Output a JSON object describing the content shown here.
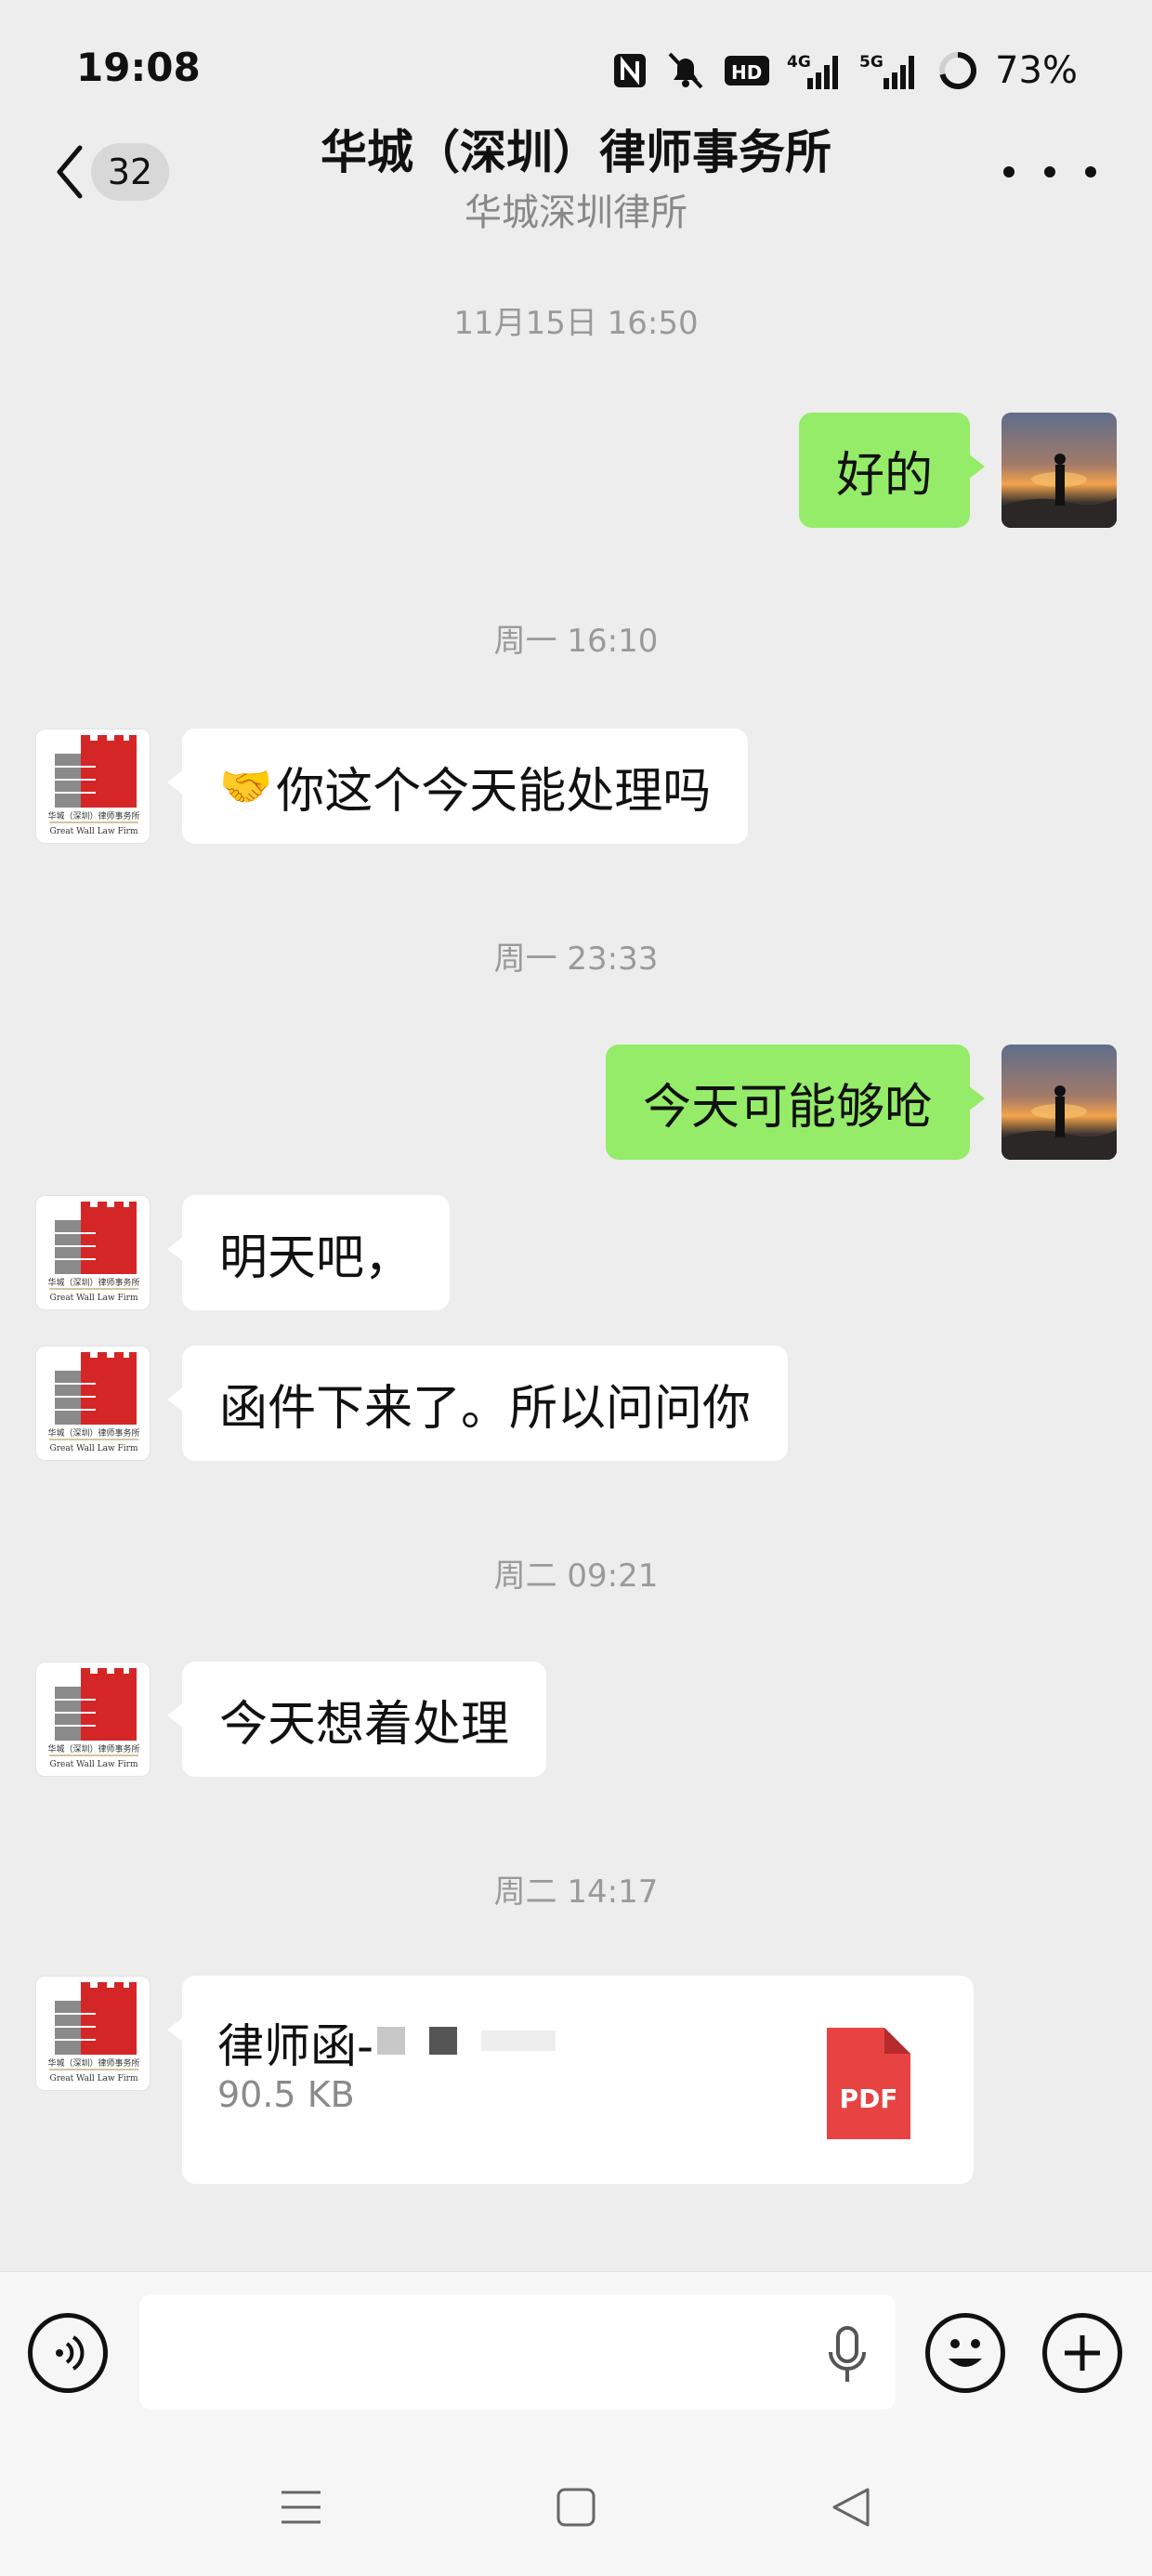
{
  "status_bar": {
    "time": "19:08",
    "icons": [
      "nfc-icon",
      "mute-icon",
      "hd-icon",
      "4g-signal-icon",
      "5g-signal-icon",
      "battery-icon"
    ],
    "hd_label": "HD",
    "net_4g": "4G",
    "net_5g": "5G",
    "battery": "73%"
  },
  "header": {
    "unread_count": "32",
    "title": "华城（深圳）律师事务所",
    "subtitle": "华城深圳律所"
  },
  "messages": [
    {
      "type": "time",
      "text": "11月15日 16:50"
    },
    {
      "type": "text",
      "from": "me",
      "text": "好的"
    },
    {
      "type": "time",
      "text": "周一 16:10"
    },
    {
      "type": "text",
      "from": "other",
      "emoji": "🤝",
      "text": "你这个今天能处理吗"
    },
    {
      "type": "time",
      "text": "周一 23:33"
    },
    {
      "type": "text",
      "from": "me",
      "text": "今天可能够呛"
    },
    {
      "type": "text",
      "from": "other",
      "text": "明天吧，"
    },
    {
      "type": "text",
      "from": "other",
      "text": "函件下来了。所以问问你"
    },
    {
      "type": "time",
      "text": "周二 09:21"
    },
    {
      "type": "text",
      "from": "other",
      "text": "今天想着处理"
    },
    {
      "type": "time",
      "text": "周二 14:17"
    },
    {
      "type": "file",
      "from": "other",
      "name": "律师函-",
      "size": "90.5 KB",
      "file_type": "PDF"
    }
  ],
  "avatar_logo": {
    "line1": "华城（深圳）律师事务所",
    "line2": "Great Wall Law Firm"
  },
  "colors": {
    "background": "#ededed",
    "my_bubble": "#95ec69",
    "other_bubble": "#ffffff",
    "pdf_red": "#e84343",
    "logo_red": "#d42626"
  },
  "input": {
    "placeholder": ""
  }
}
